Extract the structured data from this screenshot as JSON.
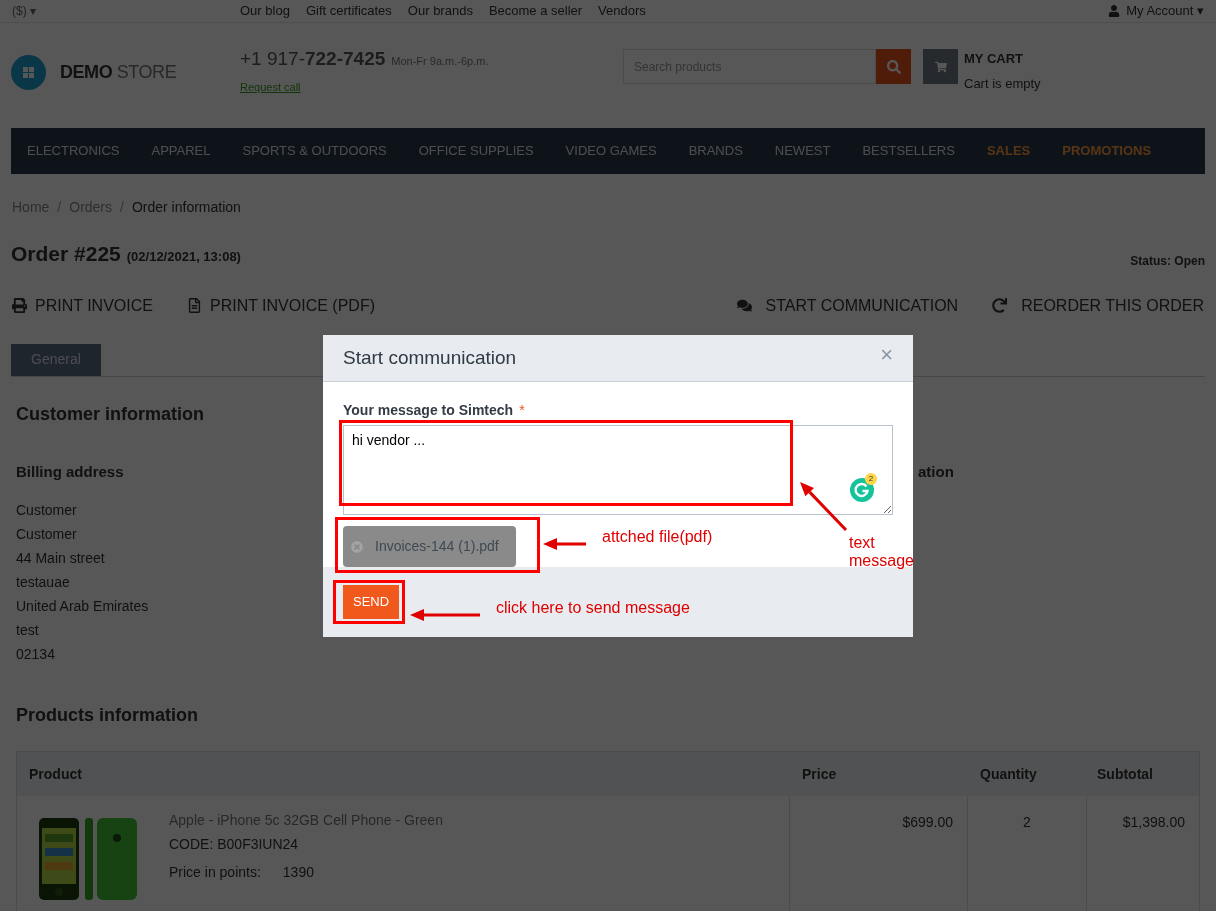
{
  "top_bar": {
    "currency": "($)",
    "currency_caret": "▾",
    "links": [
      "Our blog",
      "Gift certificates",
      "Our brands",
      "Become a seller",
      "Vendors"
    ],
    "account": "My Account",
    "account_caret": "▾"
  },
  "header": {
    "logo": {
      "bold": "DEMO",
      "light": "STORE"
    },
    "phone": "+1 917-**722-7425**",
    "hours": "Mon-Fr 9a.m.-6p.m.",
    "request_call": "Request call",
    "search": {
      "placeholder": "Search products"
    },
    "cart": {
      "title": "MY CART",
      "status": "Cart is empty"
    }
  },
  "nav": [
    {
      "label": "ELECTRONICS",
      "highlighted": false
    },
    {
      "label": "APPAREL",
      "highlighted": false
    },
    {
      "label": "SPORTS & OUTDOORS",
      "highlighted": false
    },
    {
      "label": "OFFICE SUPPLIES",
      "highlighted": false
    },
    {
      "label": "VIDEO GAMES",
      "highlighted": false
    },
    {
      "label": "BRANDS",
      "highlighted": false
    },
    {
      "label": "NEWEST",
      "highlighted": false
    },
    {
      "label": "BESTSELLERS",
      "highlighted": false
    },
    {
      "label": "SALES",
      "highlighted": true
    },
    {
      "label": "PROMOTIONS",
      "highlighted": true
    }
  ],
  "breadcrumb_separator": "/",
  "breadcrumb": [
    {
      "label": "Home",
      "current": false
    },
    {
      "label": "Orders",
      "current": false
    },
    {
      "label": "Order information",
      "current": true
    }
  ],
  "order": {
    "title": "Order #225",
    "date": "(02/12/2021, 13:08)",
    "status": "Status: Open"
  },
  "left_actions": [
    {
      "label": "PRINT INVOICE",
      "kind": "print"
    },
    {
      "label": "PRINT INVOICE (PDF)",
      "kind": "pdf"
    }
  ],
  "right_actions": [
    {
      "label": "START COMMUNICATION",
      "kind": "chat"
    },
    {
      "label": "REORDER THIS ORDER",
      "kind": "reorder"
    }
  ],
  "tabs": [
    {
      "label": "General",
      "selected": true
    }
  ],
  "customer": {
    "title": "Customer information",
    "billing": {
      "title": "Billing address",
      "lines": [
        "Customer",
        "Customer",
        "44 Main street",
        "testauae",
        "United Arab Emirates",
        "test",
        "02134"
      ]
    },
    "column_2_title": "ation"
  },
  "products": {
    "title": "Products information",
    "columns": [
      "Product",
      "Price",
      "Quantity",
      "Subtotal"
    ],
    "rows": [
      {
        "name": "Apple - iPhone 5c 32GB Cell Phone - Green",
        "code": "CODE: B00F3IUN24",
        "points_label": "Price in points:",
        "points": "1390",
        "price": "$699.00",
        "quantity": "2",
        "subtotal": "$1,398.00"
      }
    ]
  },
  "modal": {
    "title": "Start communication",
    "close": "×",
    "label": "Your message to Simtech",
    "required_mark": "*",
    "message": "hi vendor ...",
    "grammarly_count": "2",
    "attachment": "Invoices-144 (1).pdf",
    "send": "SEND"
  },
  "annotations": [
    {
      "kind": "textarea",
      "text": "text message"
    },
    {
      "kind": "file",
      "text": "attched file(pdf)"
    },
    {
      "kind": "send",
      "text": "click here to send message"
    }
  ]
}
